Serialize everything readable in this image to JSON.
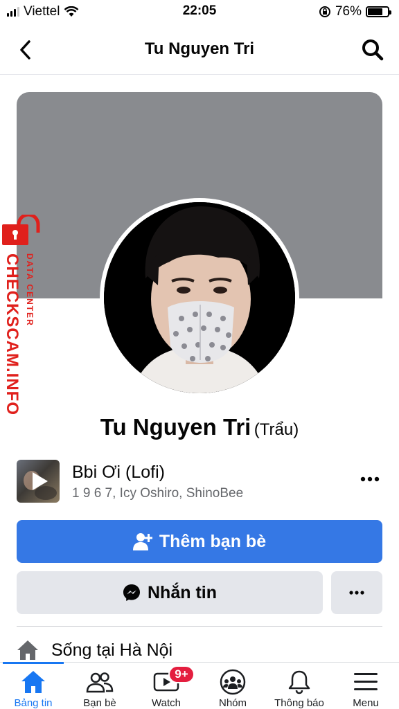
{
  "status_bar": {
    "carrier": "Viettel",
    "time": "22:05",
    "battery_percent": "76%",
    "battery_level": 0.76
  },
  "header": {
    "title": "Tu Nguyen Tri",
    "back_icon": "chevron-left-icon",
    "search_icon": "search-icon"
  },
  "profile": {
    "name": "Tu Nguyen Tri",
    "alternate_name": "(Trẩu)"
  },
  "watermark": {
    "brand": "CHECKSCAM.INFO",
    "tagline": "DATA CENTER"
  },
  "music": {
    "song": "Bbi Ơi (Lofi)",
    "artists": "1 9 6 7, Icy Oshiro, ShinoBee"
  },
  "actions": {
    "add_friend": "Thêm bạn bè",
    "message": "Nhắn tin"
  },
  "intro": {
    "lives_in": "Sống tại Hà Nội"
  },
  "tabbar": {
    "items": [
      {
        "label": "Bảng tin",
        "icon": "home-icon",
        "active": true
      },
      {
        "label": "Bạn bè",
        "icon": "friends-icon"
      },
      {
        "label": "Watch",
        "icon": "watch-video-icon",
        "badge": "9+"
      },
      {
        "label": "Nhóm",
        "icon": "groups-icon"
      },
      {
        "label": "Thông báo",
        "icon": "bell-icon"
      },
      {
        "label": "Menu",
        "icon": "hamburger-menu-icon"
      }
    ]
  },
  "colors": {
    "primary": "#3578e5",
    "active_tab": "#1877f2",
    "badge": "#e41e3f",
    "cover": "#898b8f",
    "watermark": "#e0201c"
  }
}
